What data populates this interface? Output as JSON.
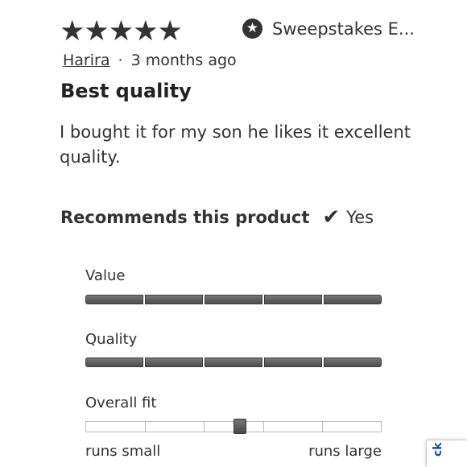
{
  "review": {
    "stars": "★★★★★",
    "rating": 5,
    "badge_icon": "star-circle-icon",
    "badge_text": "Sweepstakes E...",
    "author": "Harira",
    "separator": "·",
    "time": "3 months ago",
    "title": "Best quality",
    "body": "I bought it for my son he likes it excellent quality."
  },
  "recommend": {
    "label": "Recommends this product",
    "icon": "checkmark-icon",
    "check_glyph": "✔",
    "value": "Yes"
  },
  "ratings": {
    "value": {
      "label": "Value",
      "score": 5,
      "max": 5
    },
    "quality": {
      "label": "Quality",
      "score": 5,
      "max": 5
    },
    "fit": {
      "label": "Overall fit",
      "position": 0.5,
      "segments": 5,
      "min_label": "runs small",
      "max_label": "runs large"
    }
  },
  "feedback": {
    "label": "ck"
  },
  "colors": {
    "text": "#333333",
    "bar_fill": "#5e5e5e",
    "track_border": "#bbbbbb",
    "feedback_blue": "#1d4f91"
  }
}
